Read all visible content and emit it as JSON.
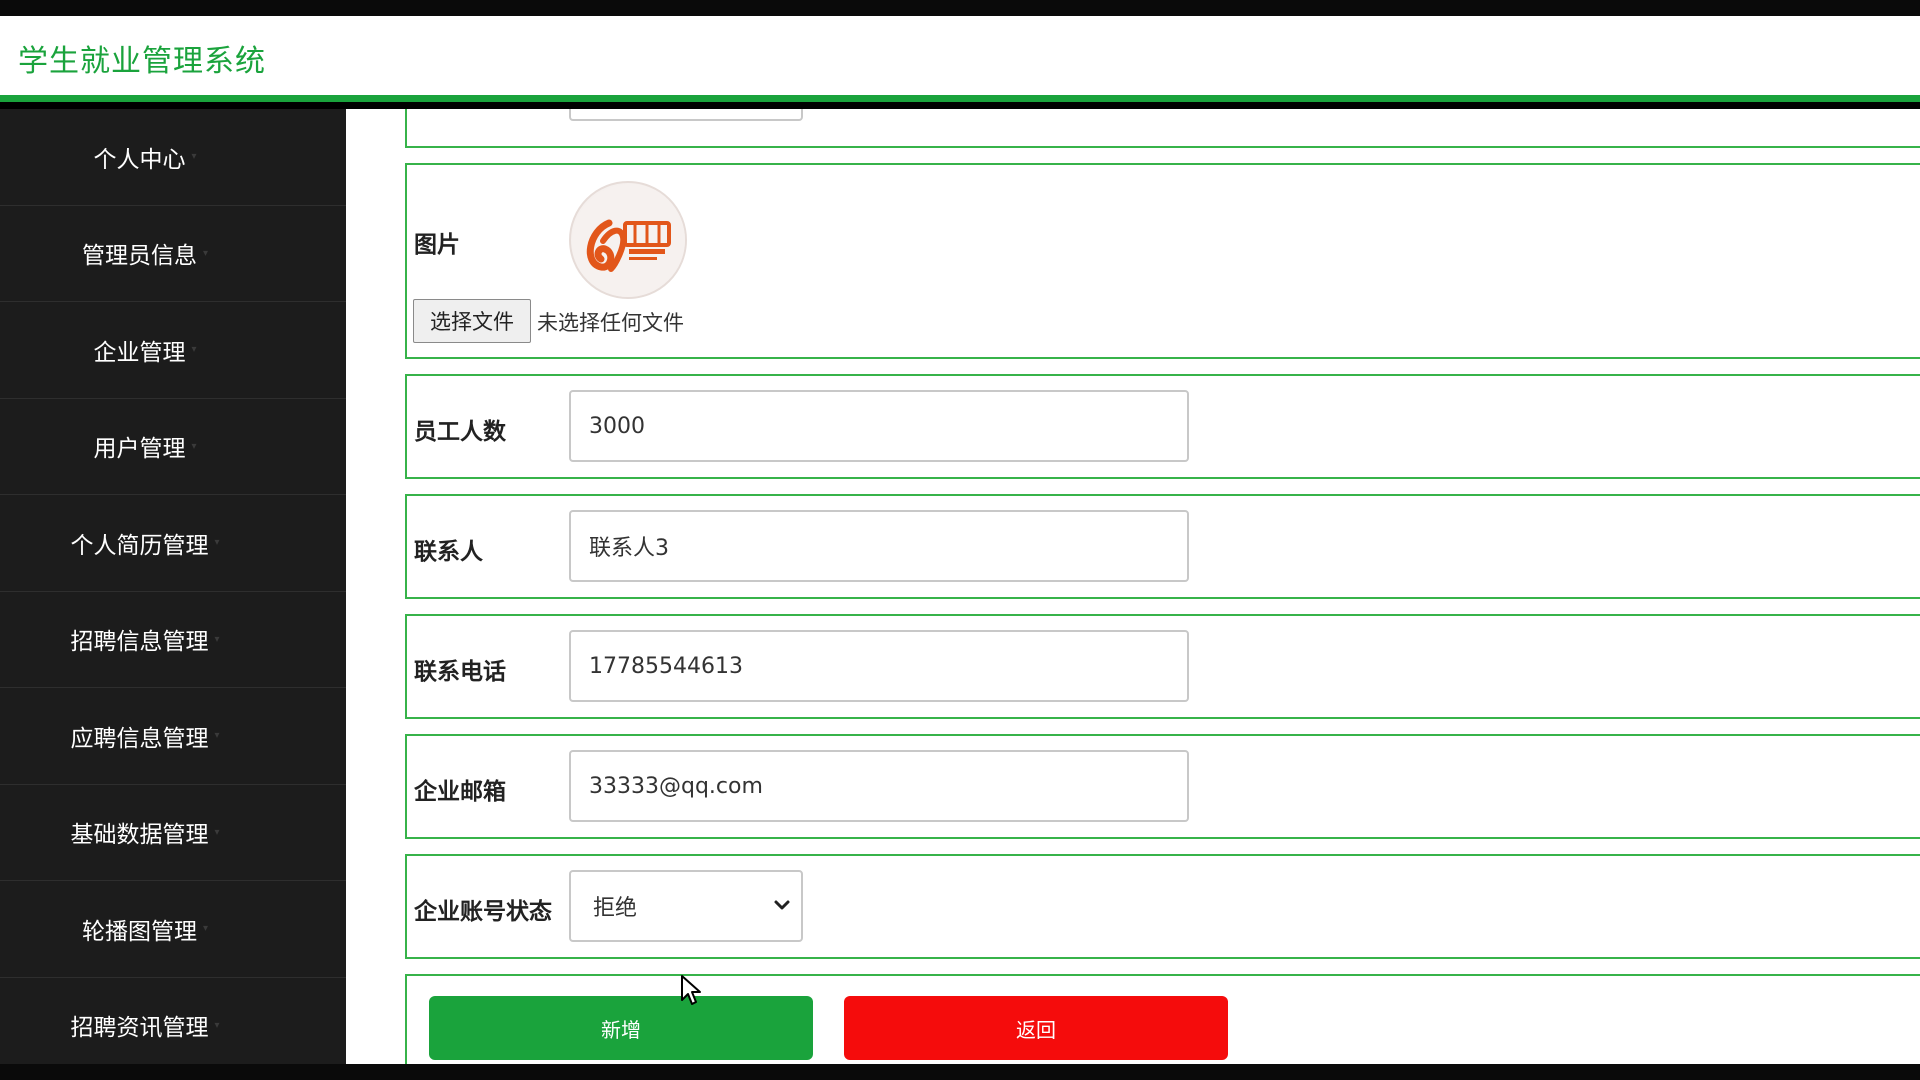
{
  "app": {
    "title": "学生就业管理系统"
  },
  "sidebar": {
    "items": [
      {
        "label": "个人中心"
      },
      {
        "label": "管理员信息"
      },
      {
        "label": "企业管理"
      },
      {
        "label": "用户管理"
      },
      {
        "label": "个人简历管理"
      },
      {
        "label": "招聘信息管理"
      },
      {
        "label": "应聘信息管理"
      },
      {
        "label": "基础数据管理"
      },
      {
        "label": "轮播图管理"
      },
      {
        "label": "招聘资讯管理"
      }
    ]
  },
  "form": {
    "image": {
      "label": "图片",
      "logo_icon": "alibaba-logo",
      "choose_file_label": "选择文件",
      "file_status": "未选择任何文件"
    },
    "employees": {
      "label": "员工人数",
      "value": "3000"
    },
    "contact": {
      "label": "联系人",
      "value": "联系人3"
    },
    "phone": {
      "label": "联系电话",
      "value": "17785544613"
    },
    "email": {
      "label": "企业邮箱",
      "value": "33333@qq.com"
    },
    "status": {
      "label": "企业账号状态",
      "value": "拒绝"
    },
    "buttons": {
      "add": "新增",
      "back": "返回"
    }
  },
  "colors": {
    "accent": "#1aa33c",
    "danger": "#f50c0c",
    "sidebar_bg": "#1c1c1c"
  }
}
